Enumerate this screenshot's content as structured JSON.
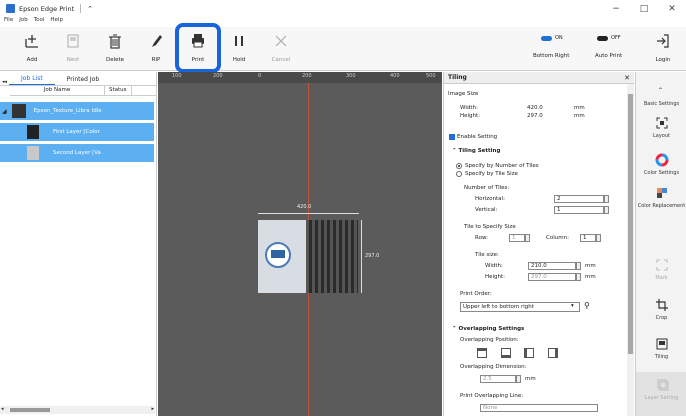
{
  "window": {
    "title": "Epson Edge Print"
  },
  "menu": [
    "File",
    "Job",
    "Tool",
    "Help"
  ],
  "toolbar": {
    "add": "Add",
    "nest": "Nest",
    "delete": "Delete",
    "rip": "RIP",
    "print": "Print",
    "hold": "Hold",
    "cancel": "Cancel",
    "toggle1_state": "ON",
    "toggle1_label": "Bottom Right",
    "toggle2_state": "OFF",
    "toggle2_label": "Auto Print",
    "login": "Login"
  },
  "left": {
    "tabs": [
      "Job List",
      "Printed Job"
    ],
    "columns": [
      "Job Name",
      "Status"
    ],
    "jobs": [
      {
        "name": "Epson_Texture_Libra",
        "status": "Idle"
      },
      {
        "name": "First Layer [Color",
        "status": ""
      },
      {
        "name": "Second Layer [Va",
        "status": ""
      }
    ]
  },
  "canvas": {
    "ruler": [
      "100",
      "200",
      "0",
      "200",
      "300",
      "400",
      "500"
    ],
    "width_label": "420.0",
    "height_label": "297.0"
  },
  "tiling": {
    "header": "Tiling",
    "image_size": "Image Size",
    "width_label": "Width:",
    "width_value": "420.0",
    "width_unit": "mm",
    "height_label": "Height:",
    "height_value": "297.0",
    "height_unit": "mm",
    "enable": "Enable Setting",
    "tiling_setting": "Tiling Setting",
    "opt1": "Specify by Number of Tiles",
    "opt2": "Specify by Tile Size",
    "num_tiles": "Number of Tiles:",
    "horizontal": "Horizontal:",
    "horizontal_value": "2",
    "vertical": "Vertical:",
    "vertical_value": "1",
    "tile_specify": "Tile to Specify Size",
    "row": "Row:",
    "row_value": "1",
    "column": "Column:",
    "column_value": "1",
    "tile_size": "Tile size:",
    "ts_width": "Width:",
    "ts_width_value": "210.0",
    "ts_unit": "mm",
    "ts_height": "Height:",
    "ts_height_value": "297.0",
    "print_order": "Print Order:",
    "print_order_value": "Upper left to bottom right",
    "overlap": "Overlapping Settings",
    "overlap_pos": "Overlapping Position:",
    "overlap_dim": "Overlapping Dimension:",
    "overlap_dim_value": "2.5",
    "overlap_unit": "mm",
    "print_overlap": "Print Overlapping Line:",
    "print_overlap_value": "None"
  },
  "sidebar": {
    "items": [
      "Basic Settings",
      "Layout",
      "Color Settings",
      "Color Replacement",
      "Mark",
      "Crop",
      "Tiling",
      "Layer Setting"
    ]
  }
}
